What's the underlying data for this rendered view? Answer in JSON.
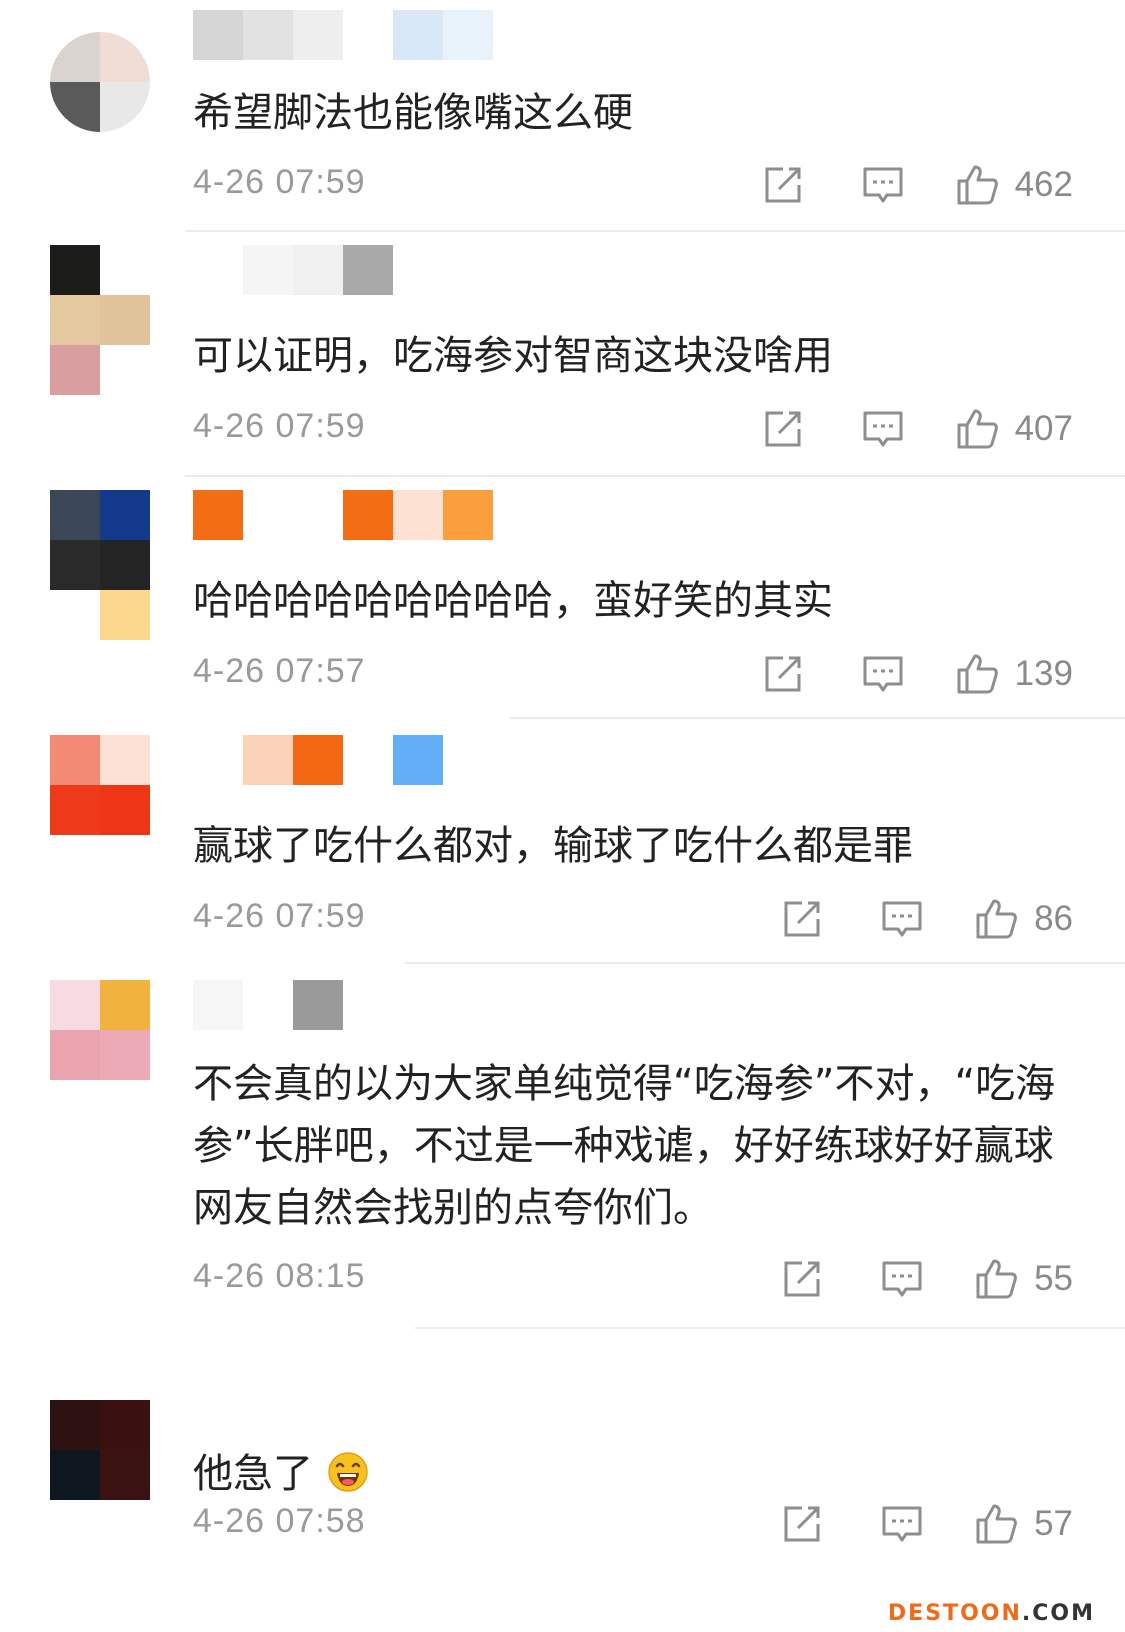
{
  "comments": [
    {
      "text": "希望脚法也能像嘴这么硬",
      "time": "4-26 07:59",
      "likes": "462"
    },
    {
      "text": "可以证明，吃海参对智商这块没啥用",
      "time": "4-26 07:59",
      "likes": "407"
    },
    {
      "text": "哈哈哈哈哈哈哈哈哈，蛮好笑的其实",
      "time": "4-26 07:57",
      "likes": "139"
    },
    {
      "text": "赢球了吃什么都对，输球了吃什么都是罪",
      "time": "4-26 07:59",
      "likes": "86"
    },
    {
      "text": "不会真的以为大家单纯觉得“吃海参”不对，“吃海参”长胖吧，不过是一种戏谑，好好练球好好赢球网友自然会找别的点夸你们。",
      "time": "4-26 08:15",
      "likes": "55"
    },
    {
      "text": "他急了",
      "time": "4-26 07:58",
      "likes": "57"
    }
  ],
  "watermark": {
    "brand": "DESTOON",
    "suffix": ".COM"
  },
  "icons": {
    "share": "share-icon",
    "reply": "comment-icon",
    "like": "thumbs-up-icon",
    "emoji": "laughing-emoji-icon"
  },
  "colors": {
    "text": "#222222",
    "meta": "#9a9a9a",
    "watermark": "#f06a1b"
  }
}
